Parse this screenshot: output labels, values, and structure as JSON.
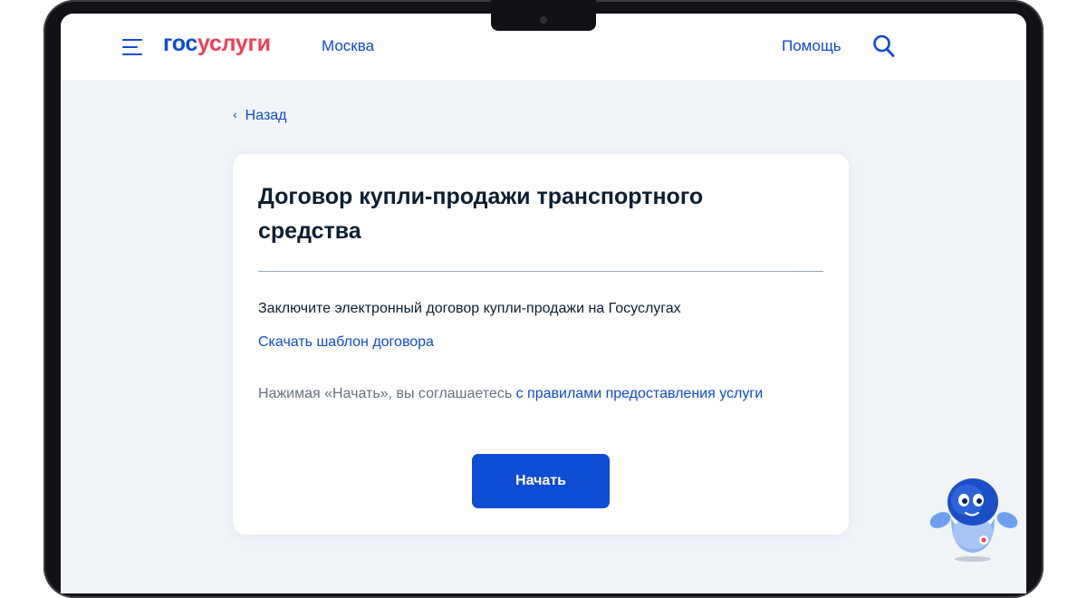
{
  "header": {
    "logo_part1": "гос",
    "logo_part2": "услуги",
    "city": "Москва",
    "help": "Помощь"
  },
  "back_label": "Назад",
  "card": {
    "title": "Договор купли-продажи транспортного средства",
    "description": "Заключите электронный договор купли-продажи на Госуслугах",
    "download_link": "Скачать шаблон договора",
    "agree_text": "Нажимая «Начать», вы соглашаетесь ",
    "agree_link": "с правилами предоставления услуги",
    "start_button": "Начать"
  },
  "colors": {
    "brand_blue": "#0d4cd3",
    "brand_red": "#ee3f58",
    "page_bg": "#f1f4f9",
    "text_dark": "#0b1f33",
    "text_muted": "#66727f"
  },
  "icons": {
    "menu": "hamburger-menu-icon",
    "search": "search-icon",
    "back": "chevron-left-icon",
    "assistant": "robot-assistant-icon"
  }
}
